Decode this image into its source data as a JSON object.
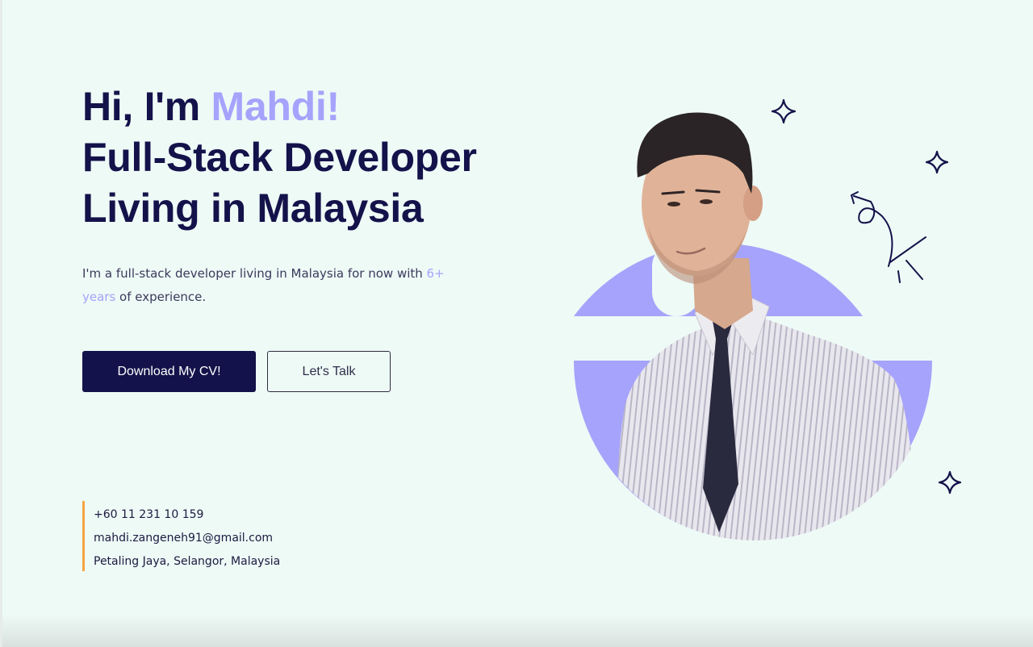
{
  "hero": {
    "greeting_prefix": "Hi, I'm ",
    "name": "Mahdi!",
    "title_line1": "Full-Stack Developer",
    "title_line2": "Living in Malaysia",
    "intro_prefix": "I'm a full-stack developer living in Malaysia for now with ",
    "intro_highlight": "6+ years",
    "intro_suffix": " of experience."
  },
  "buttons": {
    "download_cv": "Download My CV!",
    "lets_talk": "Let's Talk"
  },
  "contact": {
    "phone": "+60 11 231 10 159",
    "email": "mahdi.zangeneh91@gmail.com",
    "location": "Petaling Jaya, Selangor, Malaysia"
  },
  "colors": {
    "background": "#eefaf6",
    "primary": "#14124a",
    "accent": "#a5a3fb",
    "contact_bar": "#f5a442"
  },
  "icons": {
    "sparkle": "four-point-star",
    "doodle": "curly-arrow"
  }
}
